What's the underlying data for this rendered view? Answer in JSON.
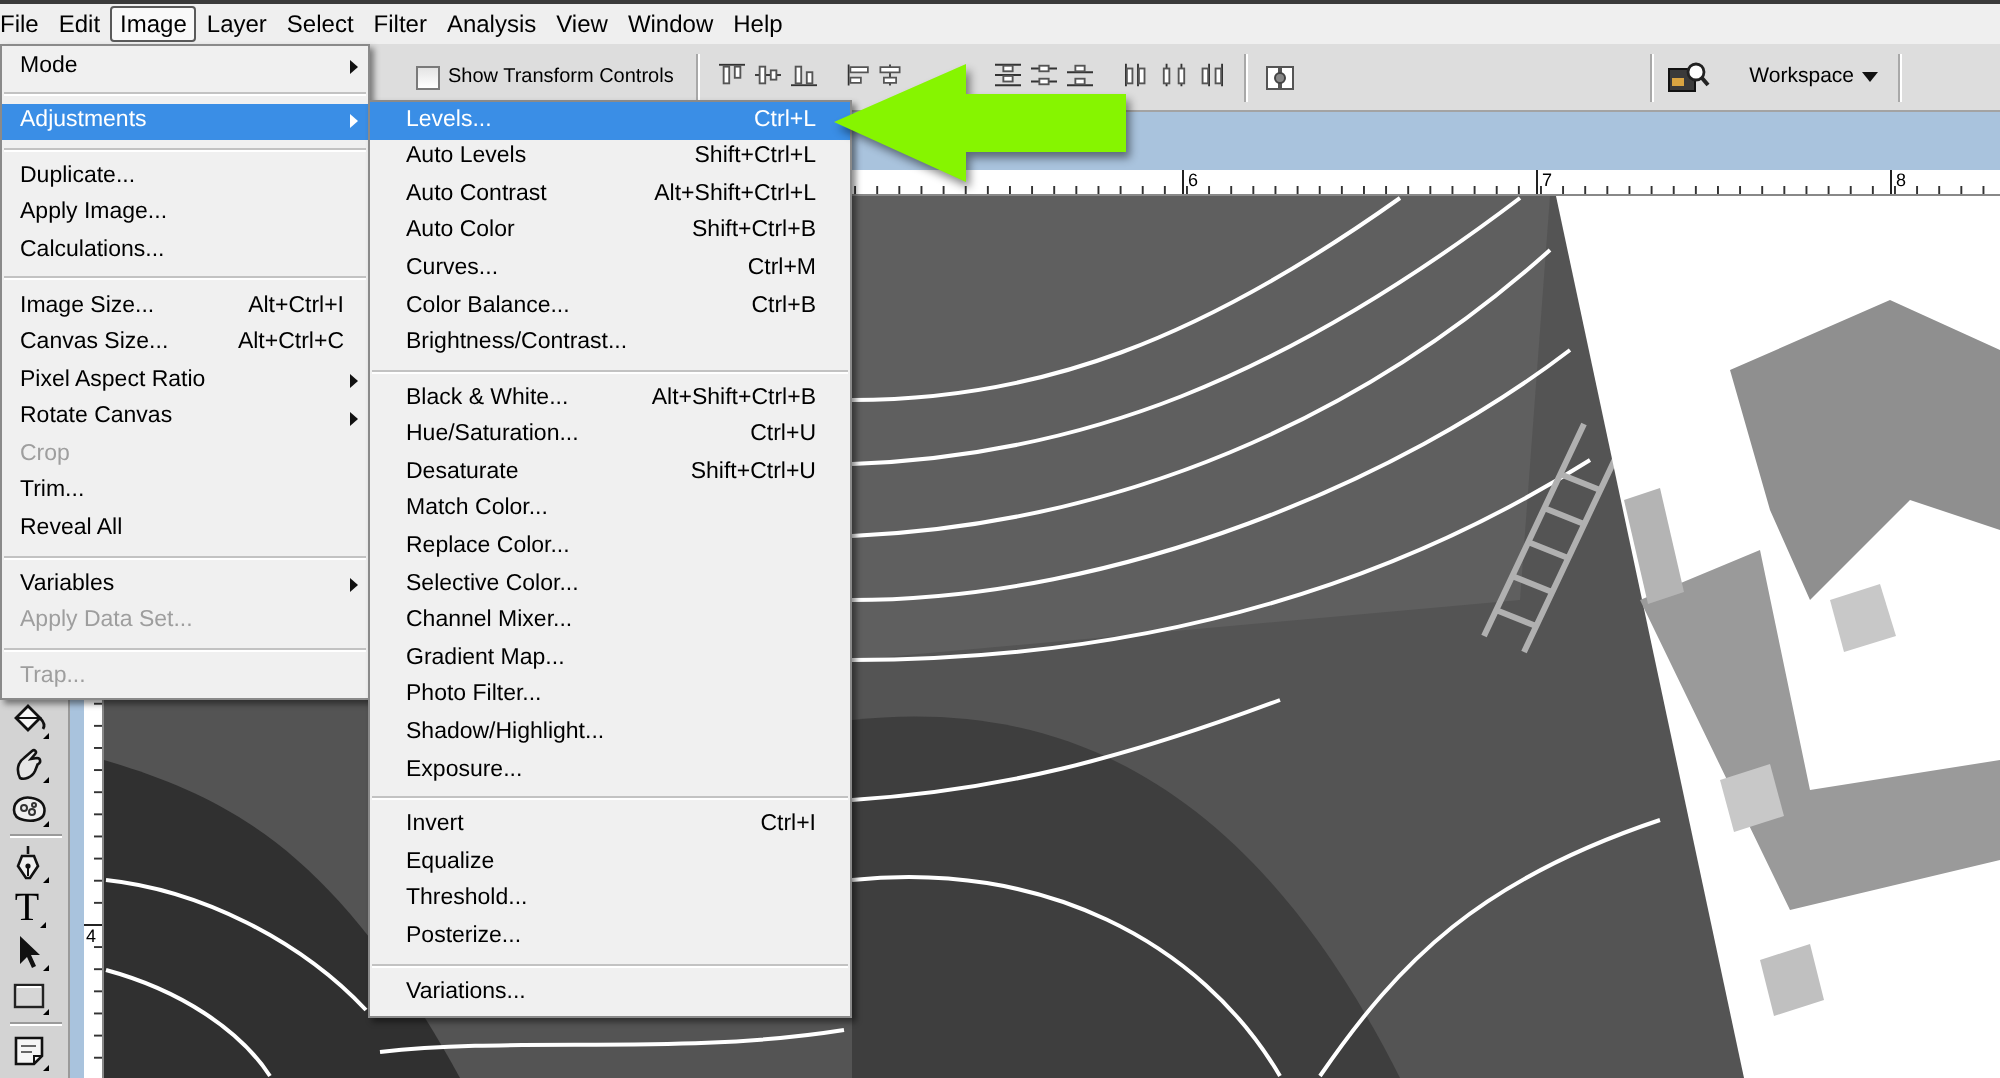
{
  "menu_bar": {
    "items": [
      {
        "label": "File",
        "selected": false
      },
      {
        "label": "Edit",
        "selected": false
      },
      {
        "label": "Image",
        "selected": true
      },
      {
        "label": "Layer",
        "selected": false
      },
      {
        "label": "Select",
        "selected": false
      },
      {
        "label": "Filter",
        "selected": false
      },
      {
        "label": "Analysis",
        "selected": false
      },
      {
        "label": "View",
        "selected": false
      },
      {
        "label": "Window",
        "selected": false
      },
      {
        "label": "Help",
        "selected": false
      }
    ]
  },
  "options_bar": {
    "transform_controls": {
      "label": "Show Transform Controls",
      "checked": false
    },
    "workspace": {
      "label": "Workspace"
    }
  },
  "toolbar": {
    "tools": [
      {
        "kind": "paint_bucket"
      },
      {
        "kind": "smudge"
      },
      {
        "kind": "sponge"
      },
      {
        "kind": "separator"
      },
      {
        "kind": "pen"
      },
      {
        "kind": "type",
        "glyph": "T"
      },
      {
        "kind": "path_selection"
      },
      {
        "kind": "rectangle"
      },
      {
        "kind": "separator"
      },
      {
        "kind": "notes"
      }
    ]
  },
  "rulers": {
    "horizontal": [
      "6",
      "7",
      "8"
    ],
    "vertical": [
      "4"
    ]
  },
  "image_menu": {
    "items": [
      {
        "kind": "item",
        "label": "Mode",
        "submenu": true,
        "disabled": false,
        "selected": false
      },
      {
        "kind": "separator"
      },
      {
        "kind": "item",
        "label": "Adjustments",
        "submenu": true,
        "disabled": false,
        "selected": true
      },
      {
        "kind": "separator"
      },
      {
        "kind": "item",
        "label": "Duplicate...",
        "submenu": false,
        "disabled": false,
        "selected": false
      },
      {
        "kind": "item",
        "label": "Apply Image...",
        "submenu": false,
        "disabled": false,
        "selected": false
      },
      {
        "kind": "item",
        "label": "Calculations...",
        "submenu": false,
        "disabled": false,
        "selected": false
      },
      {
        "kind": "separator"
      },
      {
        "kind": "item",
        "label": "Image Size...",
        "shortcut": "Alt+Ctrl+I",
        "submenu": false,
        "disabled": false,
        "selected": false
      },
      {
        "kind": "item",
        "label": "Canvas Size...",
        "shortcut": "Alt+Ctrl+C",
        "submenu": false,
        "disabled": false,
        "selected": false
      },
      {
        "kind": "item",
        "label": "Pixel Aspect Ratio",
        "submenu": true,
        "disabled": false,
        "selected": false
      },
      {
        "kind": "item",
        "label": "Rotate Canvas",
        "submenu": true,
        "disabled": false,
        "selected": false
      },
      {
        "kind": "item",
        "label": "Crop",
        "submenu": false,
        "disabled": true,
        "selected": false
      },
      {
        "kind": "item",
        "label": "Trim...",
        "submenu": false,
        "disabled": false,
        "selected": false
      },
      {
        "kind": "item",
        "label": "Reveal All",
        "submenu": false,
        "disabled": false,
        "selected": false
      },
      {
        "kind": "separator"
      },
      {
        "kind": "item",
        "label": "Variables",
        "submenu": true,
        "disabled": false,
        "selected": false
      },
      {
        "kind": "item",
        "label": "Apply Data Set...",
        "submenu": false,
        "disabled": true,
        "selected": false
      },
      {
        "kind": "separator"
      },
      {
        "kind": "item",
        "label": "Trap...",
        "submenu": false,
        "disabled": true,
        "selected": false
      }
    ]
  },
  "adjustments_menu": {
    "items": [
      {
        "kind": "item",
        "label": "Levels...",
        "shortcut": "Ctrl+L",
        "selected": true
      },
      {
        "kind": "item",
        "label": "Auto Levels",
        "shortcut": "Shift+Ctrl+L",
        "selected": false
      },
      {
        "kind": "item",
        "label": "Auto Contrast",
        "shortcut": "Alt+Shift+Ctrl+L",
        "selected": false
      },
      {
        "kind": "item",
        "label": "Auto Color",
        "shortcut": "Shift+Ctrl+B",
        "selected": false
      },
      {
        "kind": "item",
        "label": "Curves...",
        "shortcut": "Ctrl+M",
        "selected": false
      },
      {
        "kind": "item",
        "label": "Color Balance...",
        "shortcut": "Ctrl+B",
        "selected": false
      },
      {
        "kind": "item",
        "label": "Brightness/Contrast...",
        "selected": false
      },
      {
        "kind": "separator"
      },
      {
        "kind": "item",
        "label": "Black & White...",
        "shortcut": "Alt+Shift+Ctrl+B",
        "selected": false
      },
      {
        "kind": "item",
        "label": "Hue/Saturation...",
        "shortcut": "Ctrl+U",
        "selected": false
      },
      {
        "kind": "item",
        "label": "Desaturate",
        "shortcut": "Shift+Ctrl+U",
        "selected": false
      },
      {
        "kind": "item",
        "label": "Match Color...",
        "selected": false
      },
      {
        "kind": "item",
        "label": "Replace Color...",
        "selected": false
      },
      {
        "kind": "item",
        "label": "Selective Color...",
        "selected": false
      },
      {
        "kind": "item",
        "label": "Channel Mixer...",
        "selected": false
      },
      {
        "kind": "item",
        "label": "Gradient Map...",
        "selected": false
      },
      {
        "kind": "item",
        "label": "Photo Filter...",
        "selected": false
      },
      {
        "kind": "item",
        "label": "Shadow/Highlight...",
        "selected": false
      },
      {
        "kind": "item",
        "label": "Exposure...",
        "selected": false
      },
      {
        "kind": "separator"
      },
      {
        "kind": "item",
        "label": "Invert",
        "shortcut": "Ctrl+I",
        "selected": false
      },
      {
        "kind": "item",
        "label": "Equalize",
        "selected": false
      },
      {
        "kind": "item",
        "label": "Threshold...",
        "selected": false
      },
      {
        "kind": "item",
        "label": "Posterize...",
        "selected": false
      },
      {
        "kind": "separator"
      },
      {
        "kind": "item",
        "label": "Variations...",
        "selected": false
      }
    ]
  }
}
